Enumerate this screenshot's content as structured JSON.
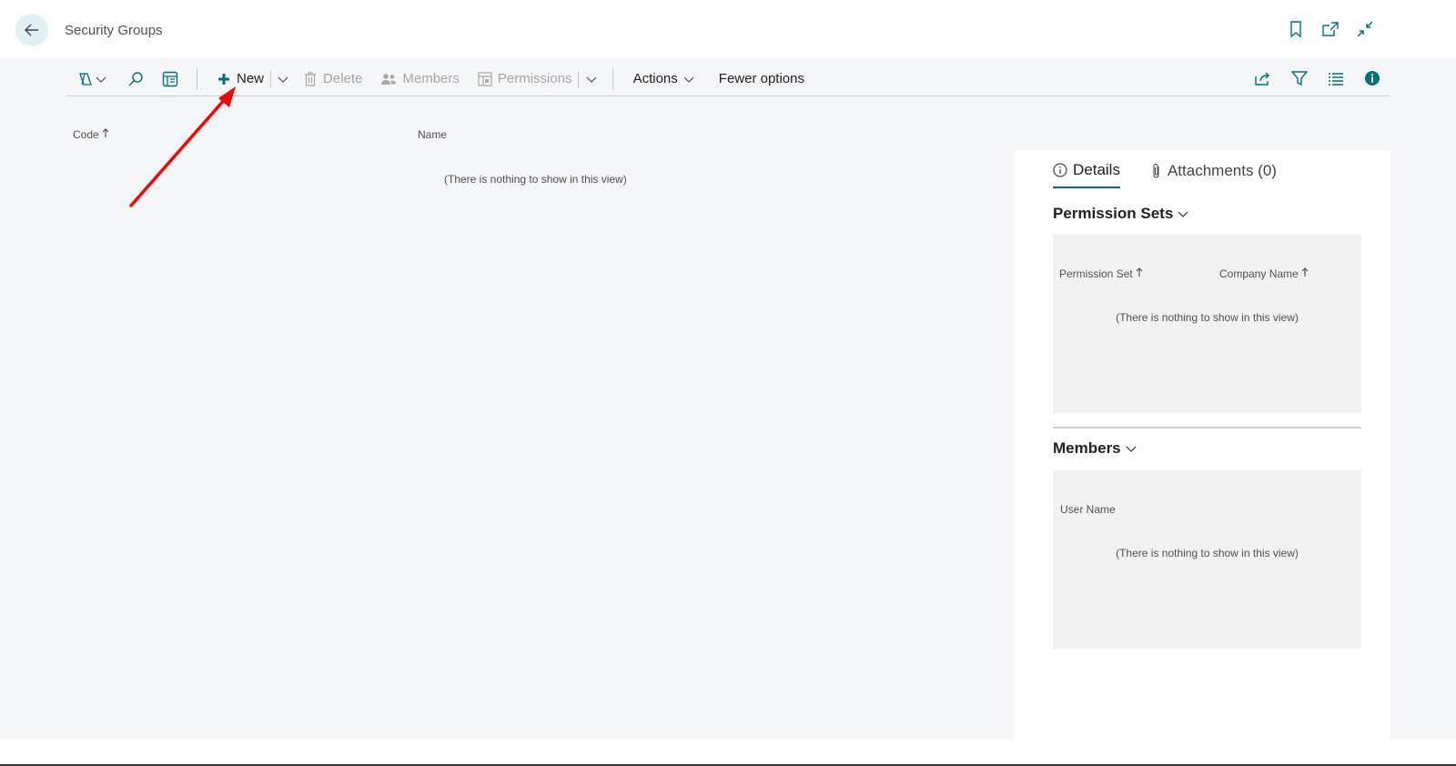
{
  "header": {
    "title": "Security Groups",
    "icons": [
      "back-arrow-icon",
      "bookmark-icon",
      "open-new-window-icon",
      "collapse-icon"
    ]
  },
  "toolbar": {
    "new_label": "New",
    "delete_label": "Delete",
    "members_label": "Members",
    "permissions_label": "Permissions",
    "actions_label": "Actions",
    "fewer_options_label": "Fewer options"
  },
  "list": {
    "columns": {
      "code": "Code",
      "name": "Name"
    },
    "empty_message": "(There is nothing to show in this view)"
  },
  "factbox": {
    "tabs": {
      "details": "Details",
      "attachments": "Attachments (0)"
    },
    "permission_sets": {
      "title": "Permission Sets",
      "col_permission_set": "Permission Set",
      "col_company_name": "Company Name",
      "empty_message": "(There is nothing to show in this view)"
    },
    "members": {
      "title": "Members",
      "col_user_name": "User Name",
      "empty_message": "(There is nothing to show in this view)"
    }
  },
  "colors": {
    "accent": "#00707a",
    "annotation": "#ff0000",
    "content_bg": "#f5f6f8"
  }
}
